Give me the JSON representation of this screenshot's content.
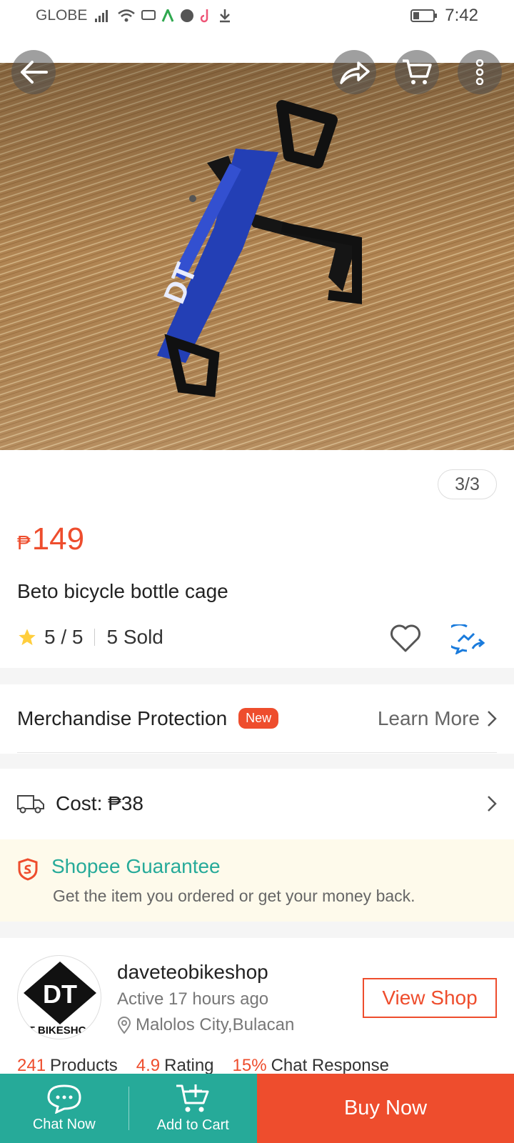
{
  "status_bar": {
    "carrier": "GLOBE",
    "time": "7:42"
  },
  "gallery": {
    "counter": "3/3"
  },
  "product": {
    "currency": "₱",
    "price": "149",
    "title": "Beto bicycle bottle cage",
    "rating": "5 / 5",
    "sold": "5 Sold"
  },
  "protection": {
    "label": "Merchandise Protection",
    "badge": "New",
    "link": "Learn More"
  },
  "shipping": {
    "cost": "Cost: ₱38"
  },
  "guarantee": {
    "title": "Shopee Guarantee",
    "subtitle": "Get the item you ordered or get your money back."
  },
  "shop": {
    "logo_text": "DT",
    "logo_subtext": "T BIKESHC",
    "name": "daveteobikeshop",
    "active": "Active 17 hours ago",
    "location": "Malolos City,Bulacan",
    "view_label": "View Shop",
    "stats": [
      {
        "value": "241",
        "label": "Products"
      },
      {
        "value": "4.9",
        "label": "Rating"
      },
      {
        "value": "15%",
        "label": "Chat Response"
      }
    ]
  },
  "bottom_bar": {
    "chat": "Chat Now",
    "cart": "Add to Cart",
    "buy": "Buy Now"
  },
  "colors": {
    "brand": "#ee4d2d",
    "teal": "#26aa99"
  }
}
